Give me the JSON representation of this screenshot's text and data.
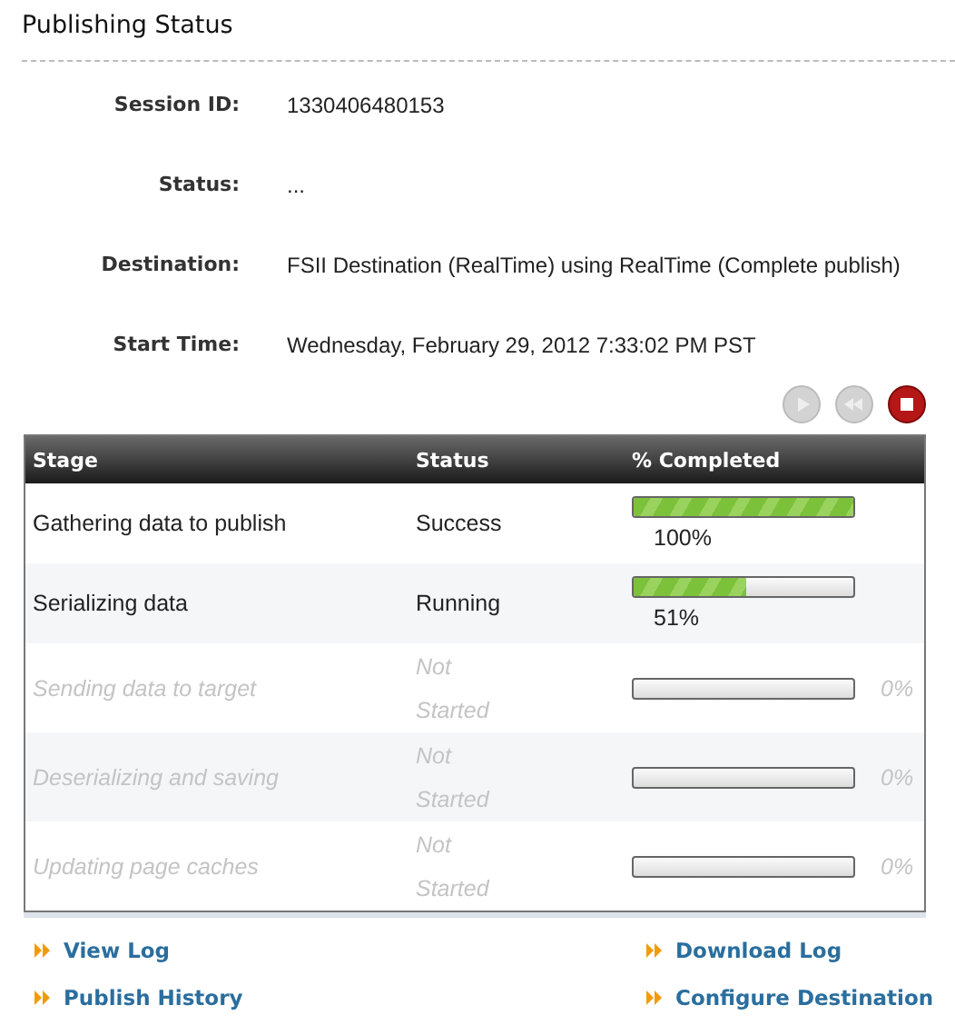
{
  "title": "Publishing Status",
  "details": [
    {
      "label": "Session ID:",
      "value": "1330406480153"
    },
    {
      "label": "Status:",
      "value": "..."
    },
    {
      "label": "Destination:",
      "value": "FSII Destination (RealTime) using RealTime (Complete publish)"
    },
    {
      "label": "Start Time:",
      "value": "Wednesday, February 29, 2012 7:33:02 PM PST"
    }
  ],
  "controls": [
    {
      "kind": "play",
      "disabled": true
    },
    {
      "kind": "rewind",
      "disabled": true
    },
    {
      "kind": "stop",
      "disabled": false
    }
  ],
  "table": {
    "columns": [
      "Stage",
      "Status",
      "% Completed"
    ],
    "rows": [
      {
        "stage": "Gathering data to publish",
        "status": "Success",
        "level": 1,
        "percent": "100%",
        "kind": "active"
      },
      {
        "stage": "Serializing data",
        "status": "Running",
        "level": 0.51,
        "percent": "51%",
        "kind": "active"
      },
      {
        "stage": "Sending data to target",
        "status": "Not Started",
        "percent": "0%",
        "kind": "pending"
      },
      {
        "stage": "Deserializing and saving",
        "status": "Not Started",
        "percent": "0%",
        "kind": "pending"
      },
      {
        "stage": "Updating page caches",
        "status": "Not Started",
        "percent": "0%",
        "kind": "pending"
      }
    ]
  },
  "links": [
    {
      "label": "View Log"
    },
    {
      "label": "Download Log"
    },
    {
      "label": "Publish History"
    },
    {
      "label": "Configure Destination"
    }
  ]
}
